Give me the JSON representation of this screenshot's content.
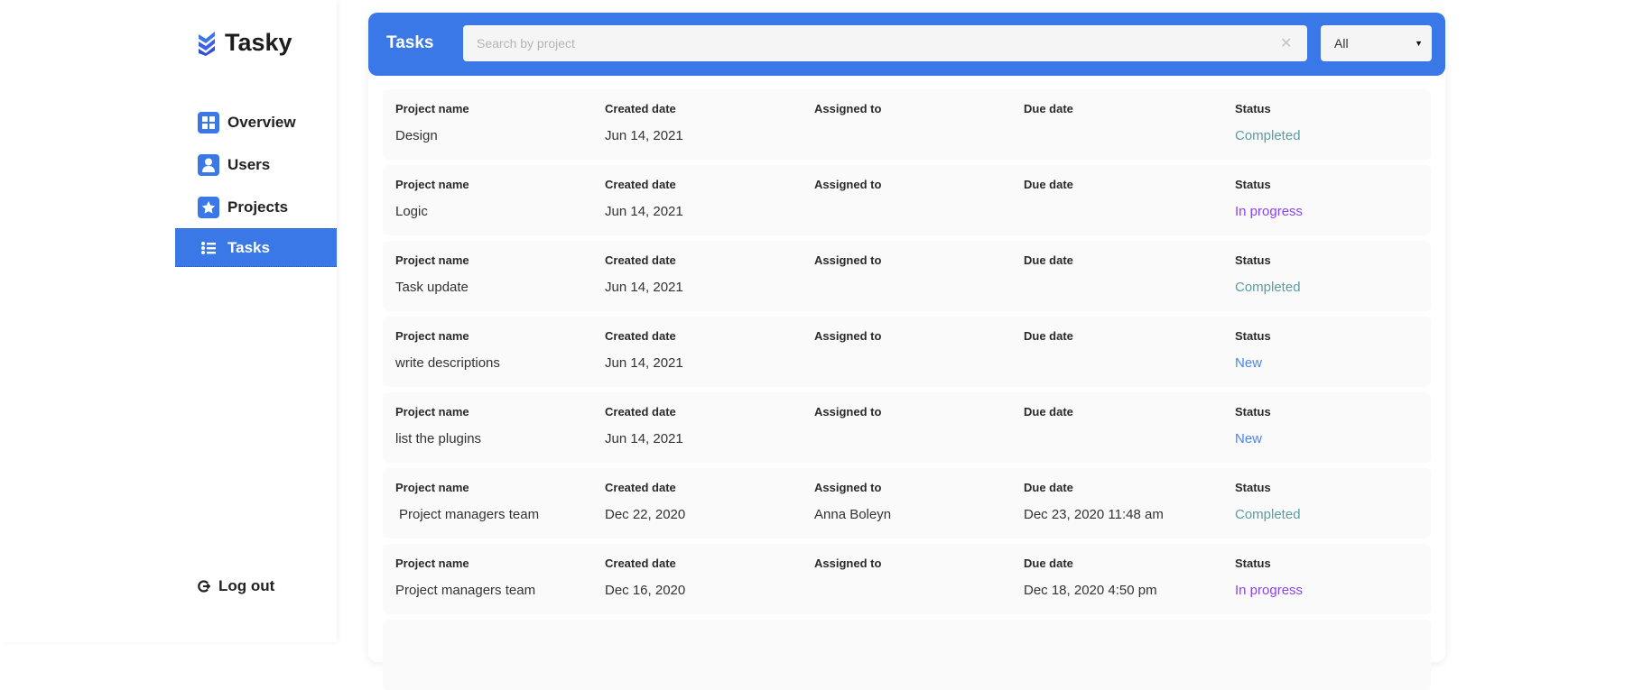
{
  "app": {
    "name": "Tasky"
  },
  "sidebar": {
    "items": [
      {
        "label": "Overview",
        "icon": "grid-icon"
      },
      {
        "label": "Users",
        "icon": "user-icon"
      },
      {
        "label": "Projects",
        "icon": "star-icon"
      },
      {
        "label": "Tasks",
        "icon": "list-icon",
        "active": true
      }
    ],
    "logout": "Log out"
  },
  "header": {
    "title": "Tasks",
    "search_placeholder": "Search by project",
    "search_value": "",
    "clear": "✕",
    "filter": "All"
  },
  "columns": {
    "project": "Project name",
    "created": "Created date",
    "assigned": "Assigned to",
    "due": "Due date",
    "status": "Status"
  },
  "rows": [
    {
      "project": "Design",
      "created": "Jun 14, 2021",
      "assigned": "",
      "due": "",
      "status": "Completed"
    },
    {
      "project": "Logic",
      "created": "Jun 14, 2021",
      "assigned": "",
      "due": "",
      "status": "In progress"
    },
    {
      "project": "Task update",
      "created": "Jun 14, 2021",
      "assigned": "",
      "due": "",
      "status": "Completed"
    },
    {
      "project": "write descriptions",
      "created": "Jun 14, 2021",
      "assigned": "",
      "due": "",
      "status": "New"
    },
    {
      "project": "list the plugins",
      "created": "Jun 14, 2021",
      "assigned": "",
      "due": "",
      "status": "New"
    },
    {
      "project": " Project managers team",
      "created": "Dec 22, 2020",
      "assigned": "Anna Boleyn",
      "due": "Dec 23, 2020 11:48 am",
      "status": "Completed"
    },
    {
      "project": "Project managers team",
      "created": "Dec 16, 2020",
      "assigned": "",
      "due": "Dec 18, 2020 4:50 pm",
      "status": "In progress"
    }
  ],
  "colors": {
    "accent": "#3b78e7",
    "completed": "#5a9ea2",
    "in_progress": "#8a44f5",
    "new": "#4a86f0"
  }
}
